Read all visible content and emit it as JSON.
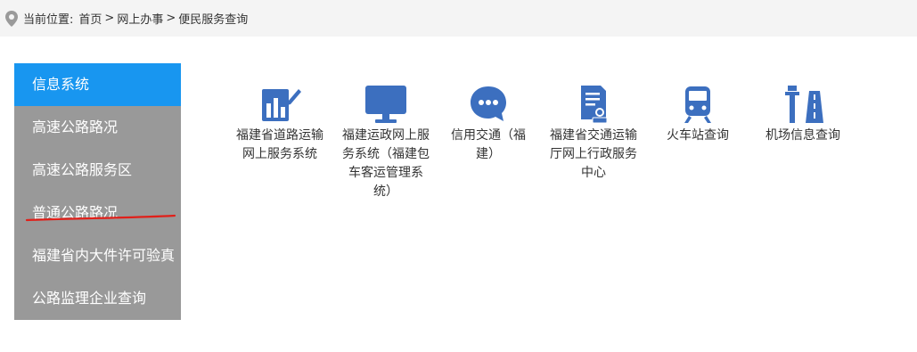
{
  "breadcrumb": {
    "prefix": "当前位置:",
    "items": [
      "首页",
      "网上办事",
      "便民服务查询"
    ],
    "separator": ">"
  },
  "sidebar": {
    "items": [
      {
        "label": "信息系统",
        "active": true
      },
      {
        "label": "高速公路路况"
      },
      {
        "label": "高速公路服务区"
      },
      {
        "label": "普通公路路况"
      },
      {
        "label": "福建省内大件许可验真"
      },
      {
        "label": "公路监理企业查询"
      }
    ]
  },
  "apps": [
    {
      "label": "福建省道路运输网上服务系统",
      "icon": "chart-edit-icon"
    },
    {
      "label": "福建运政网上服务系统（福建包车客运管理系统）",
      "icon": "monitor-icon"
    },
    {
      "label": "信用交通（福建）",
      "icon": "chat-bubble-icon"
    },
    {
      "label": "福建省交通运输厅网上行政服务中心",
      "icon": "document-stamp-icon"
    },
    {
      "label": "火车站查询",
      "icon": "train-icon"
    },
    {
      "label": "机场信息查询",
      "icon": "airport-runway-icon"
    }
  ],
  "colors": {
    "accent": "#1896f0",
    "icon_blue": "#3c6fbf",
    "sidebar_bg": "#999999",
    "underline": "#e0201a"
  }
}
